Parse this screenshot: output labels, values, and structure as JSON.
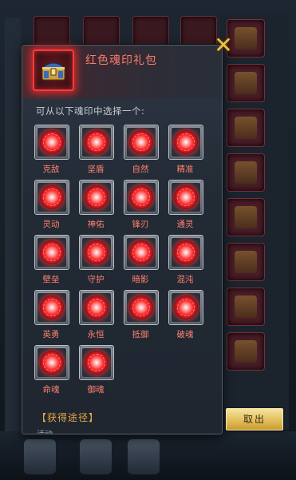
{
  "dialog": {
    "title": "红色魂印礼包",
    "subtitle": "可从以下魂印中选择一个:",
    "source_label": "【获得途径】",
    "source_text_partial": "活动",
    "cancel_label": "取出"
  },
  "soul_seals": [
    {
      "name": "克敌"
    },
    {
      "name": "坚盾"
    },
    {
      "name": "自然"
    },
    {
      "name": "精准"
    },
    {
      "name": "灵动"
    },
    {
      "name": "神佑"
    },
    {
      "name": "锋刃"
    },
    {
      "name": "通灵"
    },
    {
      "name": "壁垒"
    },
    {
      "name": "守护"
    },
    {
      "name": "暗影"
    },
    {
      "name": "混沌"
    },
    {
      "name": "英勇"
    },
    {
      "name": "永恒"
    },
    {
      "name": "抵御"
    },
    {
      "name": "破魂"
    },
    {
      "name": "命魂"
    },
    {
      "name": "御魂"
    }
  ],
  "colors": {
    "title": "#ff7a6a",
    "seal_label": "#ff8070",
    "source_label": "#e8a848",
    "close_icon": "#f0c040",
    "button": "#e0bc58"
  },
  "icons": {
    "close": "close-icon",
    "header": "treasure-chest-icon",
    "seal": "red-soul-seal-orb-icon"
  }
}
